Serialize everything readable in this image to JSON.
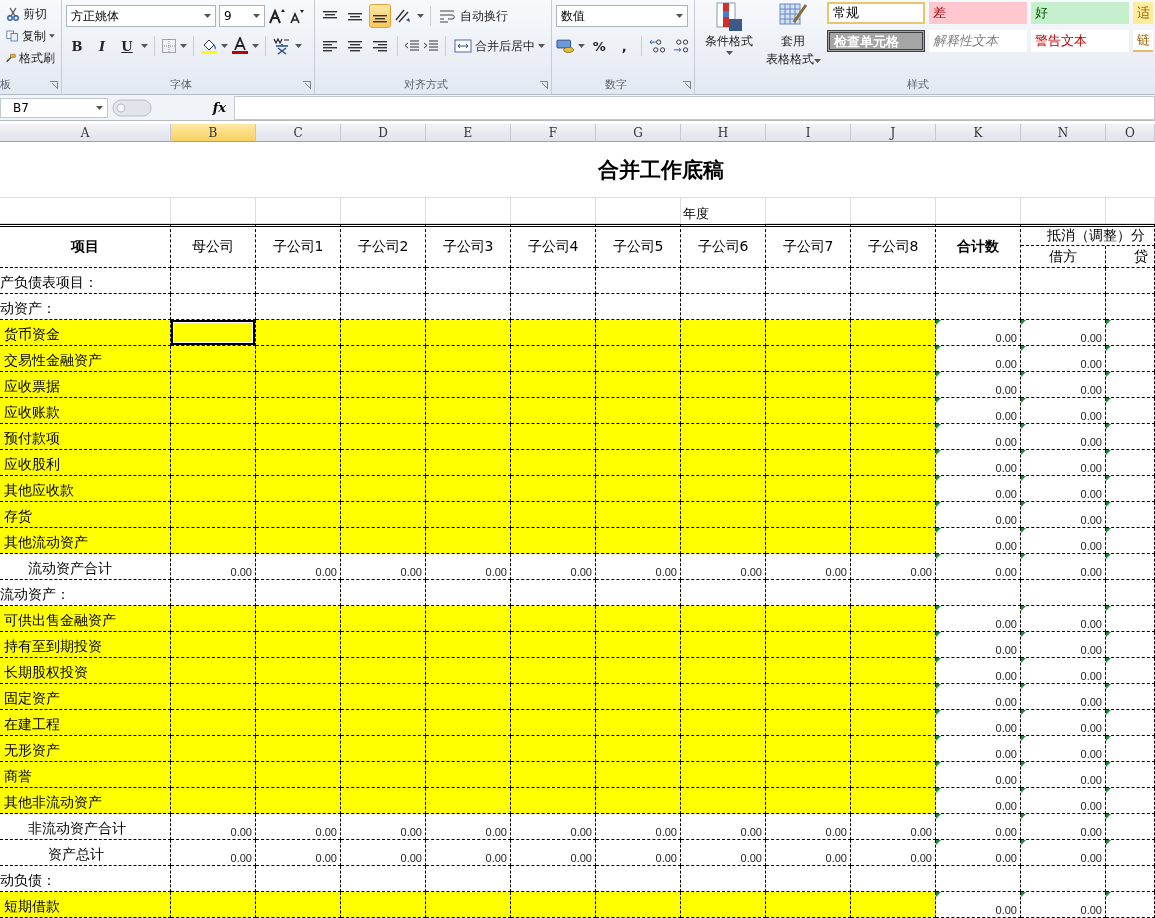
{
  "ribbon": {
    "clipboard": {
      "items": [
        {
          "label": "剪切",
          "kind": "cut"
        },
        {
          "label": "复制",
          "kind": "copy"
        },
        {
          "label": "格式刷",
          "kind": "painter"
        }
      ],
      "group_label": "板"
    },
    "font": {
      "font_name": "方正姚体",
      "font_size": "9",
      "bold": "B",
      "italic": "I",
      "underline": "U",
      "group_label": "字体"
    },
    "alignment": {
      "valign": [
        {
          "selected": false
        },
        {
          "selected": false
        },
        {
          "selected": true
        }
      ],
      "wrap_text": "自动换行",
      "merge_center": "合并后居中",
      "group_label": "对齐方式"
    },
    "number": {
      "format": "数值",
      "percent": "%",
      "comma": ",",
      "group_label": "数字"
    },
    "styles": {
      "conditional": "条件格式",
      "table_format": [
        "套用",
        "表格格式"
      ],
      "swatches": [
        {
          "label": "常规",
          "kind": "normal"
        },
        {
          "label": "差",
          "kind": "bad"
        },
        {
          "label": "好",
          "kind": "good"
        },
        {
          "label": "适",
          "kind": "neutral"
        },
        {
          "label": "检查单元格",
          "kind": "check"
        },
        {
          "label": "解释性文本",
          "kind": "explanatory"
        },
        {
          "label": "警告文本",
          "kind": "warning"
        },
        {
          "label": "链",
          "kind": "link"
        }
      ],
      "group_label": "样式"
    }
  },
  "formula_bar": {
    "name_box": "B7",
    "fx": "fx"
  },
  "columns": [
    {
      "label": "A",
      "selected": false
    },
    {
      "label": "B",
      "selected": true
    },
    {
      "label": "C",
      "selected": false
    },
    {
      "label": "D",
      "selected": false
    },
    {
      "label": "E",
      "selected": false
    },
    {
      "label": "F",
      "selected": false
    },
    {
      "label": "G",
      "selected": false
    },
    {
      "label": "H",
      "selected": false
    },
    {
      "label": "I",
      "selected": false
    },
    {
      "label": "J",
      "selected": false
    },
    {
      "label": "K",
      "selected": false
    },
    {
      "label": "N",
      "selected": false
    },
    {
      "label": "O",
      "selected": false
    }
  ],
  "sheet": {
    "title": "合并工作底稿",
    "year_label": "年度",
    "header": {
      "item": "项目",
      "entities": [
        "母公司",
        "子公司1",
        "子公司2",
        "子公司3",
        "子公司4",
        "子公司5",
        "子公司6",
        "子公司7",
        "子公司8"
      ],
      "total": "合计数",
      "elimination": "抵消（调整）分",
      "debit": "借方",
      "credit": "贷"
    },
    "rows": [
      {
        "label": "产负债表项目：",
        "kind": "section",
        "selected": false
      },
      {
        "label": "动资产：",
        "kind": "section",
        "selected": false
      },
      {
        "label": "货币资金",
        "kind": "input",
        "selected": true,
        "sum": "0.00",
        "debit": "0.00",
        "flag": true
      },
      {
        "label": "交易性金融资产",
        "kind": "input",
        "selected": false,
        "sum": "0.00",
        "debit": "0.00",
        "flag": true
      },
      {
        "label": "应收票据",
        "kind": "input",
        "selected": false,
        "sum": "0.00",
        "debit": "0.00",
        "flag": true
      },
      {
        "label": "应收账款",
        "kind": "input",
        "selected": false,
        "sum": "0.00",
        "debit": "0.00",
        "flag": true
      },
      {
        "label": "预付款项",
        "kind": "input",
        "selected": false,
        "sum": "0.00",
        "debit": "0.00",
        "flag": true
      },
      {
        "label": "应收股利",
        "kind": "input",
        "selected": false,
        "sum": "0.00",
        "debit": "0.00",
        "flag": true
      },
      {
        "label": "其他应收款",
        "kind": "input",
        "selected": false,
        "sum": "0.00",
        "debit": "0.00",
        "flag": true
      },
      {
        "label": "存货",
        "kind": "input",
        "selected": false,
        "sum": "0.00",
        "debit": "0.00",
        "flag": true
      },
      {
        "label": "其他流动资产",
        "kind": "input",
        "selected": false,
        "sum": "0.00",
        "debit": "0.00",
        "flag": true
      },
      {
        "label": "流动资产合计",
        "kind": "total",
        "selected": false,
        "values": [
          "0.00",
          "0.00",
          "0.00",
          "0.00",
          "0.00",
          "0.00",
          "0.00",
          "0.00",
          "0.00"
        ],
        "sum": "0.00",
        "debit": "0.00",
        "flag": true
      },
      {
        "label": "流动资产：",
        "kind": "section",
        "selected": false
      },
      {
        "label": "可供出售金融资产",
        "kind": "input",
        "selected": false,
        "sum": "0.00",
        "debit": "0.00",
        "flag": true
      },
      {
        "label": "持有至到期投资",
        "kind": "input",
        "selected": false,
        "sum": "0.00",
        "debit": "0.00",
        "flag": true
      },
      {
        "label": "长期股权投资",
        "kind": "input",
        "selected": false,
        "sum": "0.00",
        "debit": "0.00",
        "flag": true
      },
      {
        "label": "固定资产",
        "kind": "input",
        "selected": false,
        "sum": "0.00",
        "debit": "0.00",
        "flag": true
      },
      {
        "label": "在建工程",
        "kind": "input",
        "selected": false,
        "sum": "0.00",
        "debit": "0.00",
        "flag": true
      },
      {
        "label": "无形资产",
        "kind": "input",
        "selected": false,
        "sum": "0.00",
        "debit": "0.00",
        "flag": true
      },
      {
        "label": "商誉",
        "kind": "input",
        "selected": false,
        "sum": "0.00",
        "debit": "0.00",
        "flag": true
      },
      {
        "label": "其他非流动资产",
        "kind": "input",
        "selected": false,
        "sum": "0.00",
        "debit": "0.00",
        "flag": true
      },
      {
        "label": "非流动资产合计",
        "kind": "total",
        "selected": false,
        "values": [
          "0.00",
          "0.00",
          "0.00",
          "0.00",
          "0.00",
          "0.00",
          "0.00",
          "0.00",
          "0.00"
        ],
        "sum": "0.00",
        "debit": "0.00",
        "flag": true
      },
      {
        "label": "资产总计",
        "kind": "grand_total",
        "selected": false,
        "values": [
          "0.00",
          "0.00",
          "0.00",
          "0.00",
          "0.00",
          "0.00",
          "0.00",
          "0.00",
          "0.00"
        ],
        "sum": "0.00",
        "debit": "0.00",
        "flag": true
      },
      {
        "label": "动负债：",
        "kind": "section",
        "selected": false
      },
      {
        "label": "短期借款",
        "kind": "input",
        "selected": false,
        "sum": "0.00",
        "debit": "0.00",
        "flag": true
      }
    ]
  }
}
